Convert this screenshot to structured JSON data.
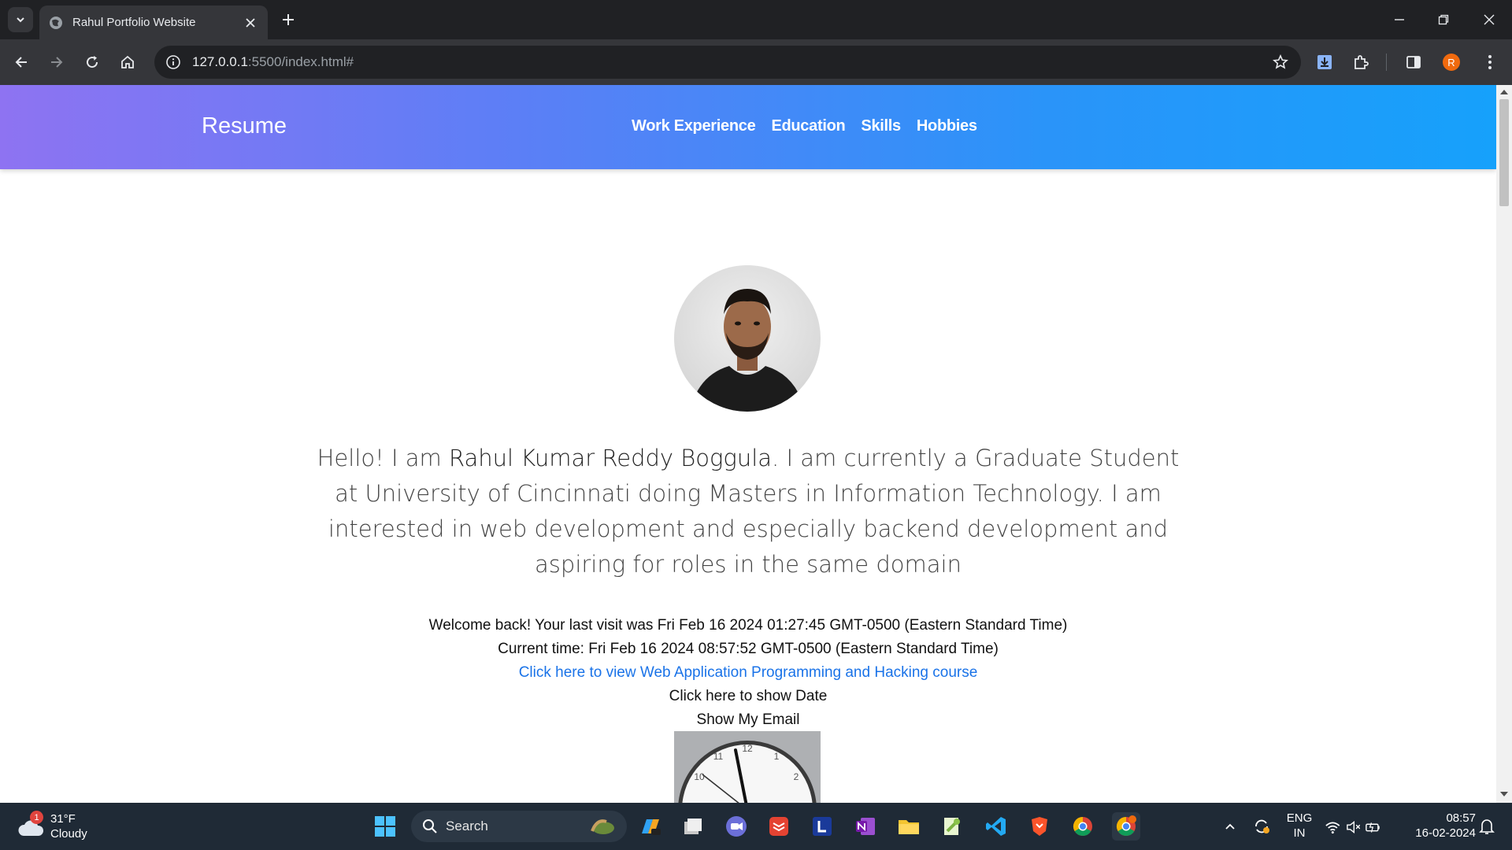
{
  "browser": {
    "tab_title": "Rahul Portfolio Website",
    "url_host": "127.0.0.1",
    "url_rest": ":5500/index.html#",
    "profile_initial": "R"
  },
  "page": {
    "navbar": {
      "brand": "Resume",
      "links": [
        "Work Experience",
        "Education",
        "Skills",
        "Hobbies"
      ]
    },
    "intro": {
      "prefix": "Hello! I am ",
      "name": "Rahul Kumar Reddy Boggula",
      "suffix": ". I am currently a Graduate Student at University of Cincinnati doing Masters in Information Technology. I am interested in web development and especially backend development and aspiring for roles in the same domain"
    },
    "welcome": "Welcome back! Your last visit was Fri Feb 16 2024 01:27:45 GMT-0500 (Eastern Standard Time)",
    "current_time": "Current time: Fri Feb 16 2024 08:57:52 GMT-0500 (Eastern Standard Time)",
    "course_link": "Click here to view Web Application Programming and Hacking course",
    "show_date": "Click here to show Date",
    "show_email": "Show My Email",
    "clock_numbers": [
      "12",
      "11",
      "1",
      "10",
      "2"
    ]
  },
  "taskbar": {
    "weather_temp": "31°F",
    "weather_desc": "Cloudy",
    "weather_badge": "1",
    "search_label": "Search",
    "lang_top": "ENG",
    "lang_bottom": "IN",
    "time": "08:57",
    "date": "16-02-2024"
  },
  "colors": {
    "nav_gradient_start": "#8e73f2",
    "nav_gradient_end": "#16a1fb",
    "link": "#1a73e8",
    "chrome_dark": "#202124",
    "taskbar": "#1f2a36"
  }
}
